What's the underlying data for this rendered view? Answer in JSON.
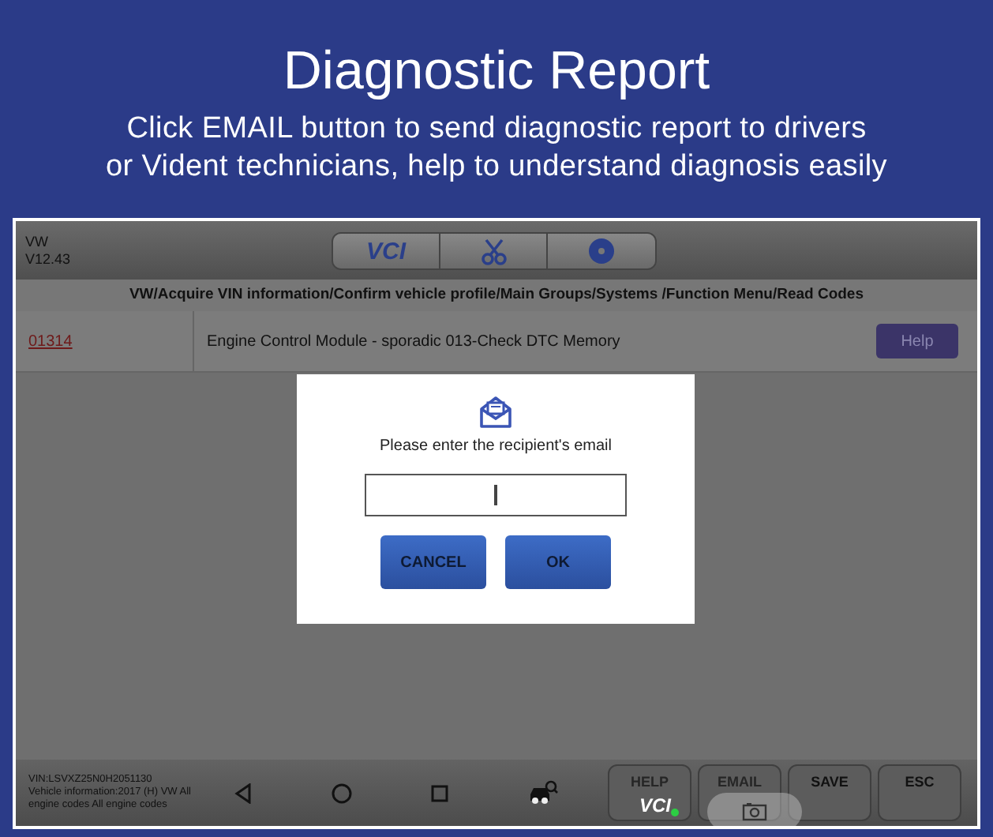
{
  "banner": {
    "title": "Diagnostic Report",
    "subtitle_lines": [
      "Click EMAIL button to send diagnostic report to drivers",
      "or Vident technicians, help to understand diagnosis easily"
    ]
  },
  "header": {
    "make": "VW",
    "version": "V12.43",
    "toolbar": [
      {
        "kind": "vci",
        "label": "VCI"
      },
      {
        "kind": "scissors"
      },
      {
        "kind": "disc"
      }
    ]
  },
  "breadcrumb": "VW/Acquire VIN information/Confirm vehicle profile/Main Groups/Systems /Function Menu/Read Codes",
  "codes": [
    {
      "code": "01314",
      "description": "Engine Control Module - sporadic 013-Check DTC Memory",
      "button": "Help"
    }
  ],
  "dialog": {
    "message": "Please enter the recipient's email",
    "buttons": [
      "CANCEL",
      "OK"
    ]
  },
  "footer": {
    "vin": "VIN:LSVXZ25N0H2051130",
    "vehicle_info": "Vehicle information:2017 (H) VW  All engine codes All engine codes",
    "nav": [
      {
        "kind": "back"
      },
      {
        "kind": "home"
      },
      {
        "kind": "recents"
      },
      {
        "kind": "car-search"
      }
    ],
    "buttons": [
      "HELP",
      "EMAIL",
      "SAVE",
      "ESC"
    ],
    "vci_label": "VCI"
  }
}
